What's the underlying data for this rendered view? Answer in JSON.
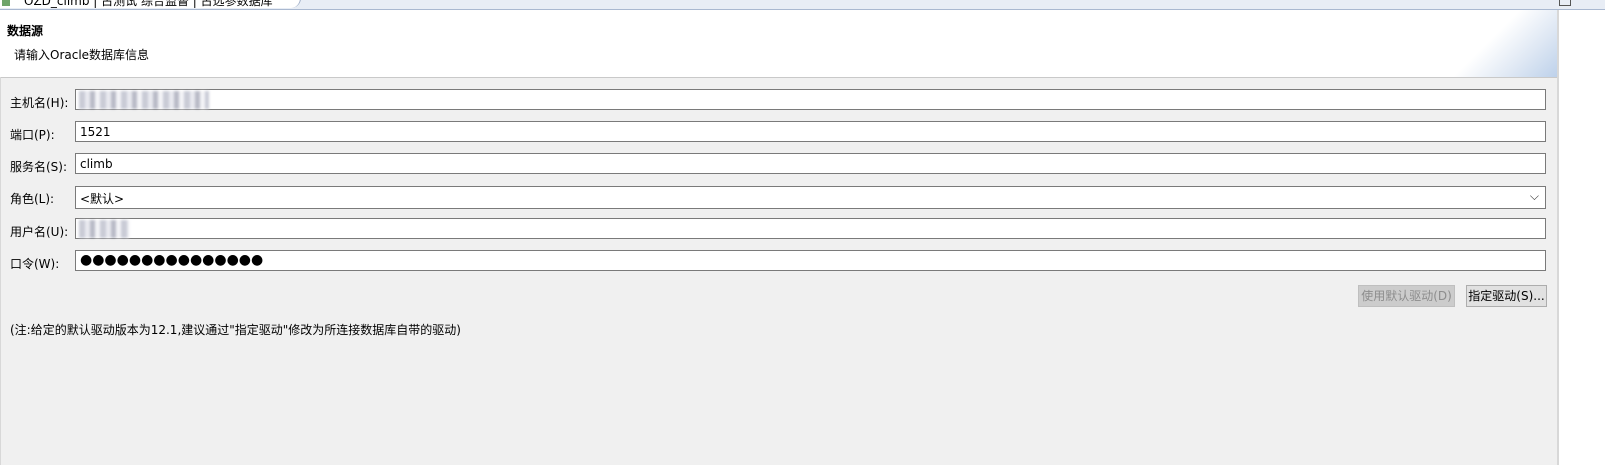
{
  "tab": {
    "label": "OZD_climb | 古测试 综合监督 | 古选参数据库",
    "icon": "database-connection-icon",
    "close_glyph": "✕"
  },
  "header": {
    "title": "数据源",
    "description": "请输入Oracle数据库信息"
  },
  "form": {
    "host": {
      "label": "主机名(H):",
      "value": ""
    },
    "port": {
      "label": "端口(P):",
      "value": "1521"
    },
    "service": {
      "label": "服务名(S):",
      "value": "climb"
    },
    "role": {
      "label": "角色(L):",
      "value": "<默认>"
    },
    "username": {
      "label": "用户名(U):",
      "value": ""
    },
    "password": {
      "label": "口令(W):",
      "value": "●●●●●●●●●●●●●●●"
    }
  },
  "buttons": {
    "use_default_driver": "使用默认驱动(D)",
    "specify_driver": "指定驱动(S)..."
  },
  "note": "(注:给定的默认驱动版本为12.1,建议通过\"指定驱动\"修改为所连接数据库自带的驱动)"
}
